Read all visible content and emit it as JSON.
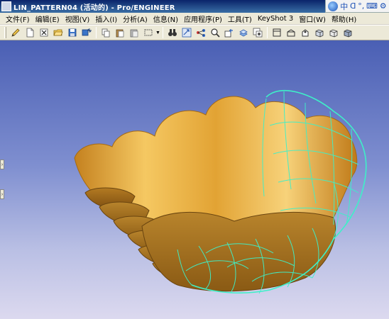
{
  "window": {
    "title": "LIN_PATTERN04 (活动的) - Pro/ENGINEER"
  },
  "ime_bar": {
    "items": [
      "中",
      "ᗡ",
      "°,",
      "⌨",
      "⚙"
    ]
  },
  "menu": [
    {
      "label": "文件(F)"
    },
    {
      "label": "编辑(E)"
    },
    {
      "label": "视图(V)"
    },
    {
      "label": "插入(I)"
    },
    {
      "label": "分析(A)"
    },
    {
      "label": "信息(N)"
    },
    {
      "label": "应用程序(P)"
    },
    {
      "label": "工具(T)"
    },
    {
      "label": "KeyShot 3"
    },
    {
      "label": "窗口(W)"
    },
    {
      "label": "帮助(H)"
    }
  ],
  "toolbar": {
    "groups": [
      [
        "edit-pencil-icon",
        "new-file-icon",
        "close-window-icon",
        "open-folder-icon",
        "save-icon",
        "save-as-icon"
      ],
      [
        "copy-icon",
        "paste-icon",
        "paste-special-icon",
        "select-box-icon"
      ],
      [
        "binoculars-icon",
        "regenerate-icon",
        "relationship-icon",
        "zoom-fit-icon",
        "datum-display-icon",
        "layer-icon",
        "appearance-icon"
      ],
      [
        "wireframe-icon",
        "hidden-line-icon",
        "no-hidden-icon",
        "shading-icon",
        "shading-edges-icon",
        "shading-reflect-icon"
      ]
    ]
  },
  "colors": {
    "viewport_top": "#4a5fb4",
    "viewport_bottom": "#dcd9ef",
    "model_gold": "#e0a530",
    "edge_highlight": "#3ef0c8"
  }
}
